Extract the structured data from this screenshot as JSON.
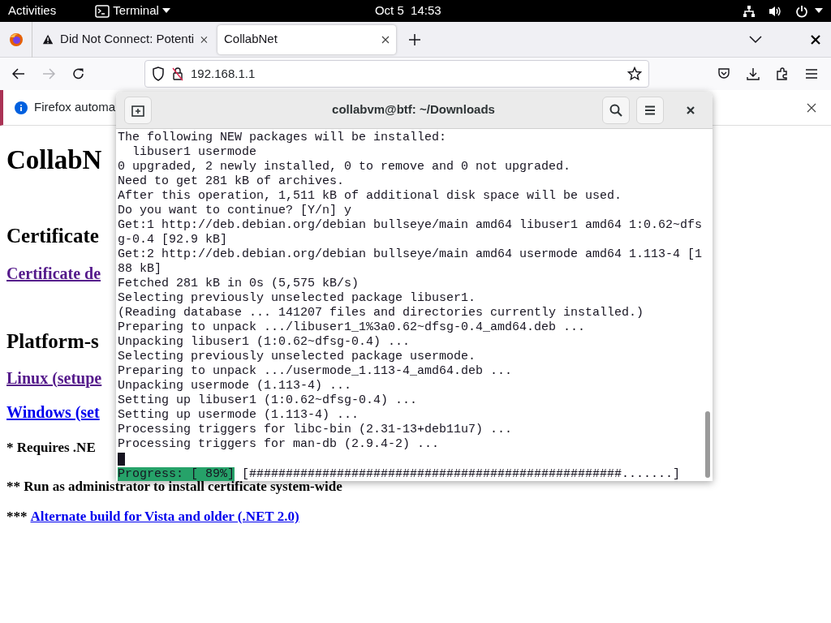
{
  "top_bar": {
    "activities": "Activities",
    "app_menu": "Terminal",
    "clock": "Oct 5  14:53"
  },
  "browser": {
    "tabs": [
      {
        "title": "Did Not Connect: Potenti",
        "kind": "warning",
        "selected": false
      },
      {
        "title": "CollabNet",
        "kind": "plain",
        "selected": true
      }
    ],
    "forward_disabled": true,
    "address": "192.168.1.1",
    "notification": "Firefox automa",
    "page": [
      {
        "kind": "h1",
        "text": "CollabN"
      },
      {
        "kind": "h2",
        "text": "Certificate"
      },
      {
        "kind": "link",
        "text": "Certificate de",
        "visited": true
      },
      {
        "kind": "h2",
        "text": "Platform-s"
      },
      {
        "kind": "link",
        "text": "Linux (setupe",
        "visited": true
      },
      {
        "kind": "link",
        "text": "Windows (set",
        "visited": false
      },
      {
        "kind": "note",
        "text": "* Requires .NE"
      },
      {
        "kind": "note",
        "text": "** Run as administrator to install certificate system-wide"
      },
      {
        "kind": "note_link",
        "prefix": "***",
        "text": "Alternate build for Vista and older (.NET 2.0)",
        "visited": false
      }
    ]
  },
  "terminal": {
    "title": "collabvm@btf: ~/Downloads",
    "lines": [
      "The following NEW packages will be installed:",
      "  libuser1 usermode",
      "0 upgraded, 2 newly installed, 0 to remove and 0 not upgraded.",
      "Need to get 281 kB of archives.",
      "After this operation, 1,511 kB of additional disk space will be used.",
      "Do you want to continue? [Y/n] y",
      "Get:1 http://deb.debian.org/debian bullseye/main amd64 libuser1 amd64 1:0.62~dfs",
      "g-0.4 [92.9 kB]",
      "Get:2 http://deb.debian.org/debian bullseye/main amd64 usermode amd64 1.113-4 [1",
      "88 kB]",
      "Fetched 281 kB in 0s (5,575 kB/s)",
      "Selecting previously unselected package libuser1.",
      "(Reading database ... 141207 files and directories currently installed.)",
      "Preparing to unpack .../libuser1_1%3a0.62~dfsg-0.4_amd64.deb ...",
      "Unpacking libuser1 (1:0.62~dfsg-0.4) ...",
      "Selecting previously unselected package usermode.",
      "Preparing to unpack .../usermode_1.113-4_amd64.deb ...",
      "Unpacking usermode (1.113-4) ...",
      "Setting up libuser1 (1:0.62~dfsg-0.4) ...",
      "Setting up usermode (1.113-4) ...",
      "Processing triggers for libc-bin (2.31-13+deb11u7) ...",
      "Processing triggers for man-db (2.9.4-2) ..."
    ],
    "progress_label": "Progress: [ 89%]",
    "progress_bar": "[###################################################.......]"
  }
}
